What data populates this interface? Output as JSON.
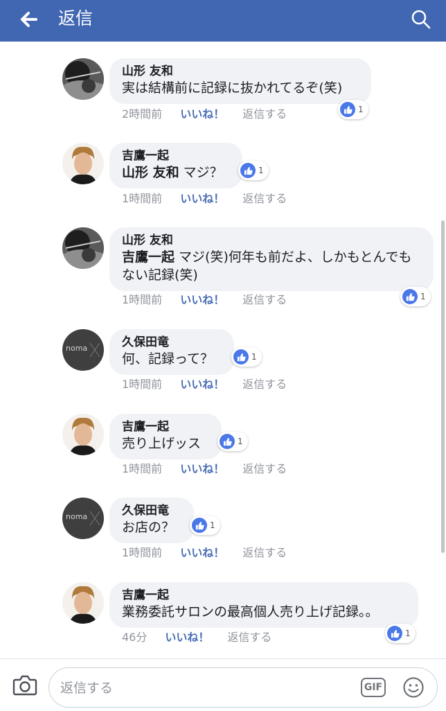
{
  "header": {
    "title": "返信",
    "back_icon": "arrow-left-icon",
    "search_icon": "search-icon"
  },
  "comments": [
    {
      "author": "山形 友和",
      "text": "実は結構前に記録に抜かれてるぞ(笑)",
      "time": "2時間前",
      "like_label": "いいね！",
      "reply_label": "返信する",
      "reactions": "1",
      "avatar": "yamagata"
    },
    {
      "author": "吉鷹一起",
      "mention": "山形 友和",
      "text": " マジ？",
      "time": "1時間前",
      "like_label": "いいね！",
      "reply_label": "返信する",
      "reactions": "1",
      "avatar": "yoshitaka"
    },
    {
      "author": "山形 友和",
      "mention": "吉鷹一起",
      "text": " マジ(笑)何年も前だよ、しかもとんでもない記録(笑)",
      "time": "1時間前",
      "like_label": "いいね！",
      "reply_label": "返信する",
      "reactions": "1",
      "avatar": "yamagata"
    },
    {
      "author": "久保田竜",
      "text": "何、記録って？",
      "time": "1時間前",
      "like_label": "いいね！",
      "reply_label": "返信する",
      "reactions": "1",
      "avatar": "kubota",
      "avatar_text": "noma"
    },
    {
      "author": "吉鷹一起",
      "text": "売り上げッス",
      "time": "1時間前",
      "like_label": "いいね！",
      "reply_label": "返信する",
      "reactions": "1",
      "avatar": "yoshitaka"
    },
    {
      "author": "久保田竜",
      "text": "お店の？",
      "time": "1時間前",
      "like_label": "いいね！",
      "reply_label": "返信する",
      "reactions": "1",
      "avatar": "kubota",
      "avatar_text": "noma"
    },
    {
      "author": "吉鷹一起",
      "text": "業務委託サロンの最高個人売り上げ記録。。",
      "time": "46分",
      "like_label": "いいね！",
      "reply_label": "返信する",
      "reactions": "1",
      "avatar": "yoshitaka"
    }
  ],
  "composer": {
    "placeholder": "返信する",
    "gif_label": "GIF",
    "camera_icon": "camera-icon",
    "sticker_icon": "smiley-icon"
  },
  "colors": {
    "header_bg": "#4267b2",
    "bubble_bg": "#f1f2f6",
    "like_blue": "#4a78e8",
    "meta_gray": "#90949c"
  }
}
